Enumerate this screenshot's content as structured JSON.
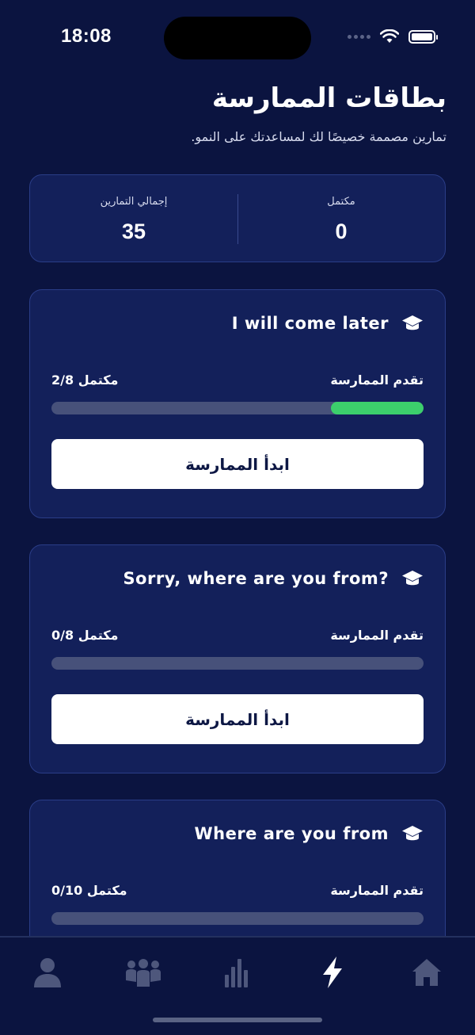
{
  "status_bar": {
    "time": "18:08"
  },
  "header": {
    "title": "بطاقات الممارسة",
    "subtitle": "تمارين مصممة خصيصًا لك لمساعدتك على النمو."
  },
  "stats": {
    "completed_label": "مكتمل",
    "completed_value": "0",
    "total_label": "إجمالي التمارين",
    "total_value": "35"
  },
  "cards": [
    {
      "title": "I will come later",
      "progress_label": "تقدم الممارسة",
      "progress_count": "2/8 مكتمل",
      "progress_fraction": 0.25,
      "button_label": "ابدأ الممارسة"
    },
    {
      "title": "Sorry, where are you from?",
      "progress_label": "تقدم الممارسة",
      "progress_count": "0/8 مكتمل",
      "progress_fraction": 0,
      "button_label": "ابدأ الممارسة"
    },
    {
      "title": "Where are you from",
      "progress_label": "تقدم الممارسة",
      "progress_count": "0/10 مكتمل",
      "progress_fraction": 0
    }
  ],
  "tab_bar": {
    "items": [
      {
        "icon": "user-icon",
        "active": false
      },
      {
        "icon": "group-icon",
        "active": false
      },
      {
        "icon": "bar-chart-icon",
        "active": false
      },
      {
        "icon": "lightning-icon",
        "active": true
      },
      {
        "icon": "home-icon",
        "active": false
      }
    ]
  },
  "colors": {
    "background": "#0b1440",
    "card": "#13205a",
    "card_border": "#2a3d87",
    "progress_fill": "#3ccf6c",
    "progress_track": "#47517a",
    "inactive_tab": "#4e577c",
    "active_tab": "#ffffff"
  }
}
